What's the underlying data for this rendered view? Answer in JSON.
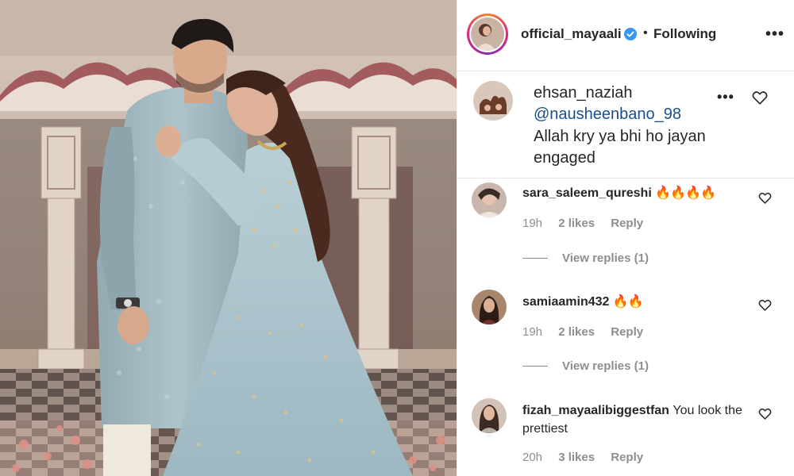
{
  "post": {
    "author": "official_mayaali",
    "follow_status": "Following",
    "dot": "•",
    "more": "•••"
  },
  "featured_comment": {
    "user": "ehsan_naziah",
    "mention": "@nausheenbano_98",
    "text": "Allah kry ya bhi ho jayan engaged",
    "more": "•••"
  },
  "comments": [
    {
      "user": "sara_saleem_qureshi",
      "text": "🔥🔥🔥🔥",
      "time": "19h",
      "likes": "2 likes",
      "reply": "Reply",
      "view_replies": "View replies (1)"
    },
    {
      "user": "samiaamin432",
      "text": "🔥🔥",
      "time": "19h",
      "likes": "2 likes",
      "reply": "Reply",
      "view_replies": "View replies (1)"
    },
    {
      "user": "fizah_mayaalibiggestfan",
      "text": "You look the prettiest",
      "time": "20h",
      "likes": "3 likes",
      "reply": "Reply"
    }
  ],
  "colors": {
    "mention": "#1a4f8a",
    "verified": "#3897f0",
    "meta": "#8e8e8e"
  },
  "icons": {
    "heart": "heart-outline-icon",
    "verified": "verified-badge-icon",
    "more": "more-options-icon"
  }
}
